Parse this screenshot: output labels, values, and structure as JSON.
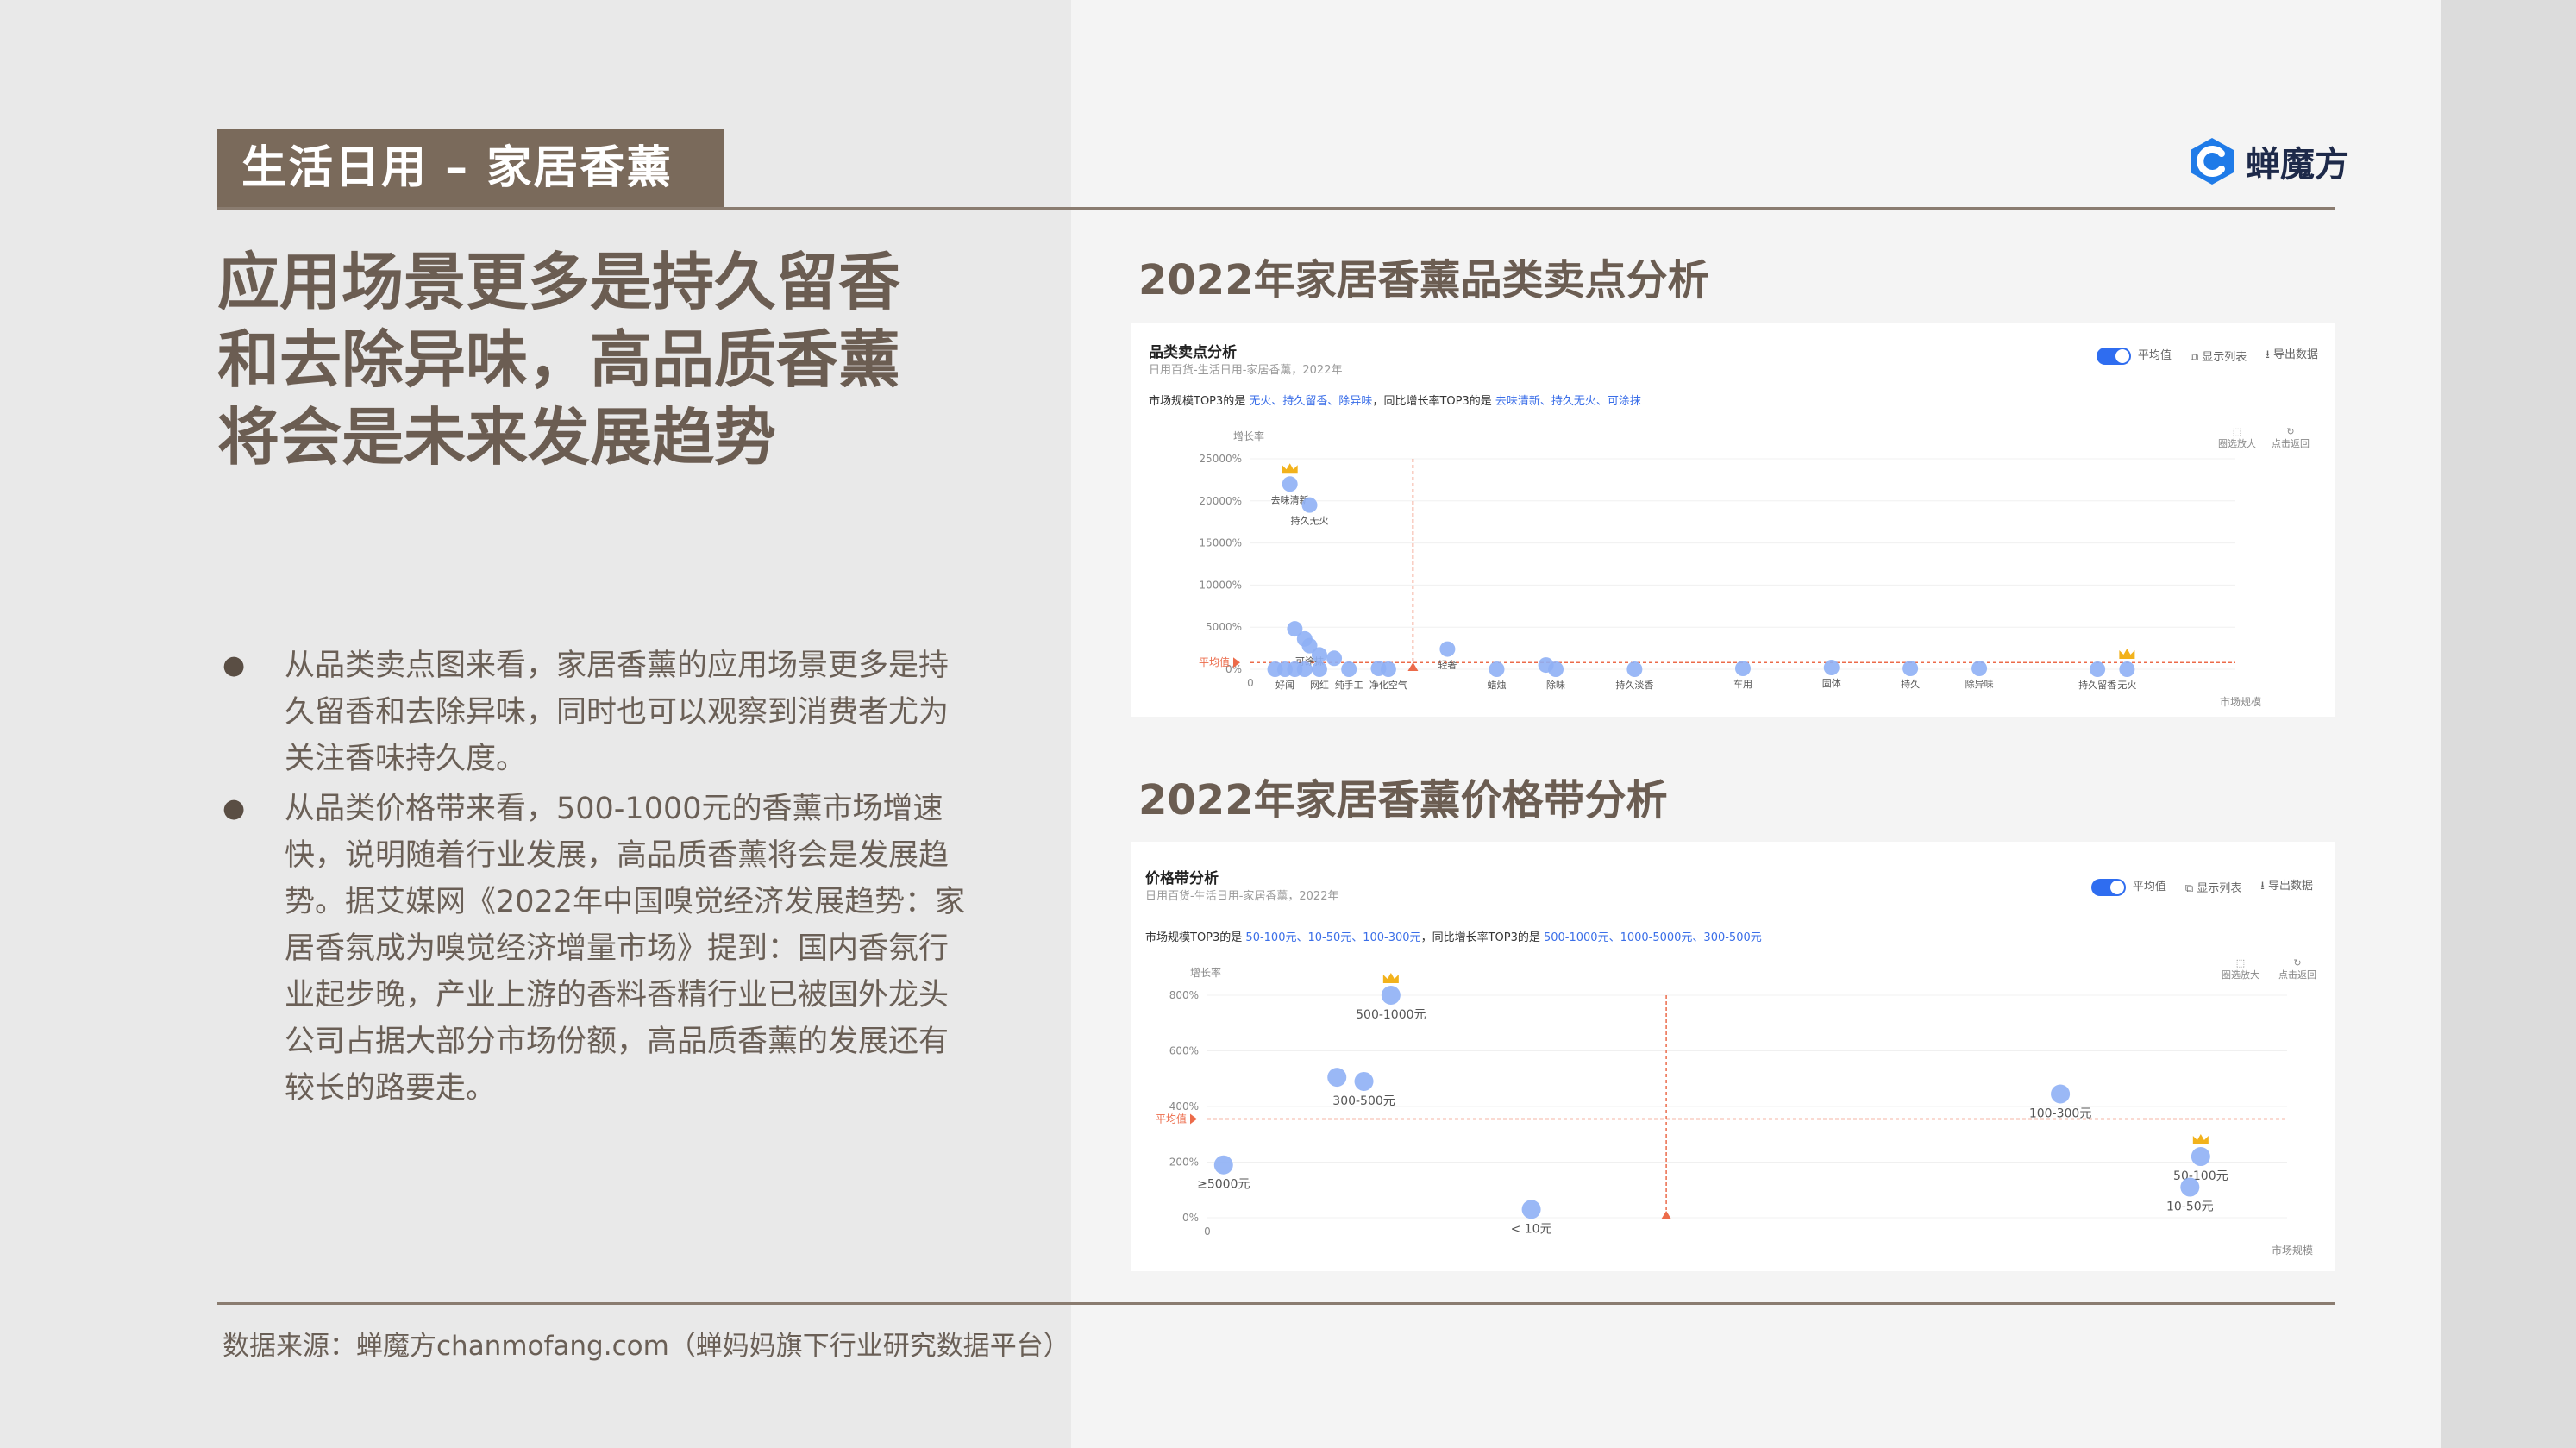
{
  "header": {
    "tag": "生活日用 – 家居香薰",
    "logo_text": "蝉魔方"
  },
  "headline": [
    "应用场景更多是持久留香",
    "和去除异味，高品质香薰",
    "将会是未来发展趋势"
  ],
  "bullets": [
    "从品类卖点图来看，家居香薰的应用场景更多是持久留香和去除异味，同时也可以观察到消费者尤为关注香味持久度。",
    "从品类价格带来看，500-1000元的香薰市场增速快，说明随着行业发展，高品质香薰将会是发展趋势。据艾媒网《2022年中国嗅觉经济发展趋势：家居香氛成为嗅觉经济增量市场》提到：国内香氛行业起步晚，产业上游的香料香精行业已被国外龙头公司占据大部分市场份额，高品质香薰的发展还有较长的路要走。"
  ],
  "source": "数据来源：蝉魔方chanmofang.com（蝉妈妈旗下行业研究数据平台）",
  "section1": {
    "title": "2022年家居香薰品类卖点分析"
  },
  "section2": {
    "title": "2022年家居香薰价格带分析"
  },
  "panel1": {
    "title": "品类卖点分析",
    "subtitle": "日用百货-生活日用-家居香薰，2022年",
    "note_prefix": "市场规模TOP3的是 ",
    "note_top": "无火、持久留香、除异味",
    "note_mid": "，同比增长率TOP3的是 ",
    "note_growth": "去味清新、持久无火、可涂抹",
    "controls": [
      "平均值",
      "显示列表",
      "导出数据"
    ],
    "mini": [
      "圈选放大",
      "点击返回"
    ]
  },
  "panel2": {
    "title": "价格带分析",
    "subtitle": "日用百货-生活日用-家居香薰，2022年",
    "note_prefix": "市场规模TOP3的是 ",
    "note_top": "50-100元、10-50元、100-300元",
    "note_mid": "，同比增长率TOP3的是 ",
    "note_growth": "500-1000元、1000-5000元、300-500元",
    "controls": [
      "平均值",
      "显示列表",
      "导出数据"
    ],
    "mini": [
      "圈选放大",
      "点击返回"
    ]
  },
  "chart_data": [
    {
      "type": "scatter",
      "title": "品类卖点分析",
      "ylabel": "增长率",
      "xlabel": "市场规模",
      "yticks": [
        "25000%",
        "20000%",
        "15000%",
        "10000%",
        "5000%",
        "0%"
      ],
      "ylim": [
        0,
        25000
      ],
      "xlim": [
        0,
        100
      ],
      "average_label": "平均值",
      "average": {
        "x": 16.5,
        "y": 800
      },
      "points": [
        {
          "label": "去味清新",
          "x": 4,
          "y": 22000,
          "crown": true
        },
        {
          "label": "持久无火",
          "x": 6,
          "y": 19500
        },
        {
          "label": "",
          "x": 4.5,
          "y": 4800
        },
        {
          "label": "",
          "x": 5.5,
          "y": 3600
        },
        {
          "label": "可涂抹",
          "x": 6,
          "y": 2800
        },
        {
          "label": "",
          "x": 7,
          "y": 1700
        },
        {
          "label": "",
          "x": 8.5,
          "y": 1300
        },
        {
          "label": "",
          "x": 2.5,
          "y": 0
        },
        {
          "label": "好闻",
          "x": 3.5,
          "y": 0
        },
        {
          "label": "",
          "x": 4.5,
          "y": 0
        },
        {
          "label": "",
          "x": 5.5,
          "y": 0
        },
        {
          "label": "网红",
          "x": 7,
          "y": 0
        },
        {
          "label": "纯手工",
          "x": 10,
          "y": 0
        },
        {
          "label": "净化空气",
          "x": 14,
          "y": 0
        },
        {
          "label": "",
          "x": 13,
          "y": 100
        },
        {
          "label": "轻奢",
          "x": 20,
          "y": 2400
        },
        {
          "label": "蜡烛",
          "x": 25,
          "y": 0
        },
        {
          "label": "",
          "x": 30,
          "y": 500
        },
        {
          "label": "除味",
          "x": 31,
          "y": 0
        },
        {
          "label": "持久淡香",
          "x": 39,
          "y": 0
        },
        {
          "label": "车用",
          "x": 50,
          "y": 100
        },
        {
          "label": "固体",
          "x": 59,
          "y": 200
        },
        {
          "label": "持久",
          "x": 67,
          "y": 100
        },
        {
          "label": "除异味",
          "x": 74,
          "y": 100
        },
        {
          "label": "持久留香",
          "x": 86,
          "y": 0
        },
        {
          "label": "无火",
          "x": 89,
          "y": 0,
          "crown": true
        }
      ]
    },
    {
      "type": "scatter",
      "title": "价格带分析",
      "ylabel": "增长率",
      "xlabel": "市场规模",
      "yticks": [
        "800%",
        "600%",
        "400%",
        "200%",
        "0%"
      ],
      "ylim": [
        0,
        800
      ],
      "xlim": [
        0,
        100
      ],
      "average_label": "平均值",
      "average": {
        "x": 42.5,
        "y": 355
      },
      "points": [
        {
          "label": "500-1000元",
          "x": 17,
          "y": 800,
          "crown": true
        },
        {
          "label": "",
          "x": 12,
          "y": 505
        },
        {
          "label": "300-500元",
          "x": 14.5,
          "y": 490
        },
        {
          "label": "≥5000元",
          "x": 1.5,
          "y": 190
        },
        {
          "label": "< 10元",
          "x": 30,
          "y": 30
        },
        {
          "label": "100-300元",
          "x": 79,
          "y": 445
        },
        {
          "label": "50-100元",
          "x": 92,
          "y": 220,
          "crown": true
        },
        {
          "label": "10-50元",
          "x": 91,
          "y": 110
        }
      ]
    }
  ]
}
